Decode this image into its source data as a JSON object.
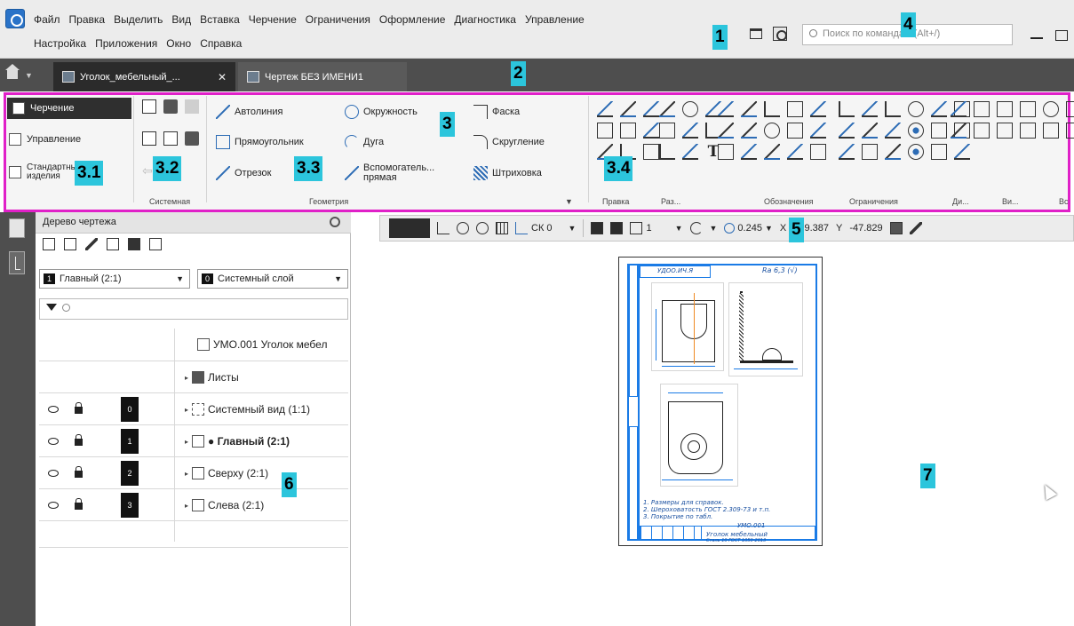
{
  "menu": {
    "row1": [
      "Файл",
      "Правка",
      "Выделить",
      "Вид",
      "Вставка",
      "Черчение",
      "Ограничения",
      "Оформление",
      "Диагностика",
      "Управление"
    ],
    "row2": [
      "Настройка",
      "Приложения",
      "Окно",
      "Справка"
    ]
  },
  "search": {
    "placeholder": "Поиск по командам (Alt+/)"
  },
  "tabs": [
    {
      "label": "Уголок_мебельный_..."
    },
    {
      "label": "Чертеж БЕЗ ИМЕНИ1"
    }
  ],
  "ribbon": {
    "modes": {
      "drawing": "Черчение",
      "management": "Управление",
      "standard_line1": "Стандартные",
      "standard_line2": "изделия"
    },
    "geometry_tools": {
      "autoline": "Автолиния",
      "circle": "Окружность",
      "chamfer": "Фаска",
      "rectangle": "Прямоугольник",
      "arc": "Дуга",
      "fillet": "Скругление",
      "segment": "Отрезок",
      "aux_line1": "Вспомогатель...",
      "aux_line2": "прямая",
      "hatch": "Штриховка"
    },
    "groups": {
      "system": "Системная",
      "geometry": "Геометрия",
      "edit": "Правка",
      "dimensions": "Раз...",
      "designations": "Обозначения",
      "constraints": "Ограничения",
      "diag": "Ди...",
      "views": "Ви...",
      "insert": "Вс"
    }
  },
  "tree": {
    "title": "Дерево чертежа",
    "view_select": {
      "num": "1",
      "label": "Главный (2:1)"
    },
    "layer_select": {
      "num": "0",
      "label": "Системный слой"
    },
    "rows": {
      "document": "УМО.001 Уголок мебел",
      "sheets": "Листы",
      "views": [
        {
          "num": "0",
          "label": "Системный вид (1:1)"
        },
        {
          "num": "1",
          "label": "● Главный (2:1)"
        },
        {
          "num": "2",
          "label": "Сверху (2:1)"
        },
        {
          "num": "3",
          "label": "Слева (2:1)"
        }
      ]
    }
  },
  "canvas_toolbar": {
    "coord_system": "СК 0",
    "step": "1",
    "zoom": "0.245",
    "x_label": "X",
    "x_value": "189.387",
    "y_label": "Y",
    "y_value": "-47.829"
  },
  "sheet": {
    "top_note": "УДОО.ИЧ.Я",
    "roughness": "Ra 6,3 (√)",
    "notes": [
      "1. Размеры для справок.",
      "2. Шероховатость ГОСТ 2.309-73 и т.п.",
      "3. Покрытие по табл."
    ],
    "designation": "УМО.001",
    "title": "Уголок мебельный",
    "material": "Сталь 10 ГОСТ 1050-2013"
  },
  "callouts": [
    "1",
    "2",
    "3",
    "3.1",
    "3.2",
    "3.3",
    "3.4",
    "4",
    "5",
    "6",
    "7"
  ],
  "colors": {
    "ribbon_highlight": "#e020c8",
    "callout_bg": "#2cc5dc",
    "frame_blue": "#1a7be6"
  }
}
